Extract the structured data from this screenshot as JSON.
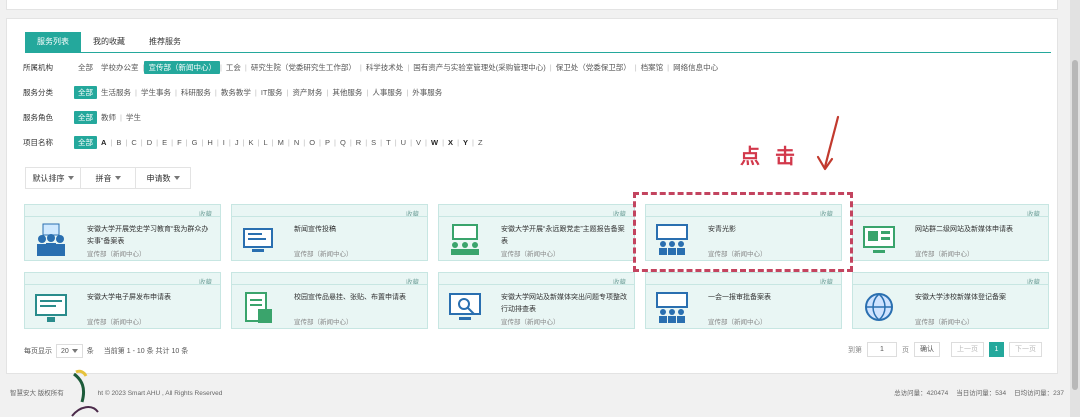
{
  "tabs": [
    {
      "label": "服务列表",
      "active": true
    },
    {
      "label": "我的收藏",
      "active": false
    },
    {
      "label": "推荐服务",
      "active": false
    }
  ],
  "filters": {
    "org": {
      "label": "所属机构",
      "items": [
        "全部",
        "学校办公室",
        "宣传部（新闻中心）",
        "工会",
        "研究生院（党委研究生工作部）",
        "科学技术处",
        "国有资产与实验室管理处(采购管理中心)",
        "保卫处（党委保卫部）",
        "档案馆",
        "网络信息中心"
      ],
      "selected": "宣传部（新闻中心）"
    },
    "category": {
      "label": "服务分类",
      "items": [
        "全部",
        "生活服务",
        "学生事务",
        "科研服务",
        "教务教学",
        "IT服务",
        "资产财务",
        "其他服务",
        "人事服务",
        "外事服务"
      ],
      "selected": "全部"
    },
    "role": {
      "label": "服务角色",
      "items": [
        "全部",
        "教师",
        "学生"
      ],
      "selected": "全部"
    },
    "name": {
      "label": "项目名称",
      "items": [
        "全部",
        "A",
        "B",
        "C",
        "D",
        "E",
        "F",
        "G",
        "H",
        "I",
        "J",
        "K",
        "L",
        "M",
        "N",
        "O",
        "P",
        "Q",
        "R",
        "S",
        "T",
        "U",
        "V",
        "W",
        "X",
        "Y",
        "Z"
      ],
      "selected": "全部",
      "bold": [
        "A",
        "W",
        "X",
        "Y"
      ]
    }
  },
  "sort": [
    "默认排序",
    "拼音",
    "申请数"
  ],
  "fav_label": "收藏",
  "cards": [
    {
      "title": "安徽大学开展党史学习教育“我为群众办实事”备案表",
      "dept": "宣传部（新闻中心）",
      "icon": "people-group-icon"
    },
    {
      "title": "新闻宣传投稿",
      "dept": "宣传部（新闻中心）",
      "icon": "monitor-edit-icon"
    },
    {
      "title": "安徽大学开展“永远跟党走”主题报告备案表",
      "dept": "宣传部（新闻中心）",
      "icon": "meeting-icon"
    },
    {
      "title": "安青光影",
      "dept": "宣传部（新闻中心）",
      "icon": "presentation-icon"
    },
    {
      "title": "网站群二级网站及新媒体申请表",
      "dept": "宣传部（新闻中心）",
      "icon": "desktop-icon"
    },
    {
      "title": "安徽大学电子屏发布申请表",
      "dept": "宣传部（新闻中心）",
      "icon": "screen-icon"
    },
    {
      "title": "校园宣传品悬挂、张贴、布置申请表",
      "dept": "宣传部（新闻中心）",
      "icon": "document-icon"
    },
    {
      "title": "安徽大学网站及新媒体突出问题专项整改行动排查表",
      "dept": "宣传部（新闻中心）",
      "icon": "search-screen-icon"
    },
    {
      "title": "一会一报审批备案表",
      "dept": "宣传部（新闻中心）",
      "icon": "presentation-icon"
    },
    {
      "title": "安徽大学涉校新媒体登记备案",
      "dept": "宣传部（新闻中心）",
      "icon": "globe-icon"
    }
  ],
  "annotation": "点 击",
  "pager": {
    "per_page_label": "每页显示",
    "per_page_value": "20",
    "per_page_unit": "条",
    "summary": "当前第 1 - 10 条 共计 10 条",
    "goto_label": "到第",
    "goto_value": "1",
    "page_unit": "页",
    "go_label": "确认",
    "prev_label": "上一页",
    "current_page": "1",
    "next_label": "下一页"
  },
  "footer": {
    "left_a": "智慧安大 版权所有",
    "left_b": "ht © 2023 Smart AHU , All Rights Reserved",
    "total_visits": "总访问量：420474",
    "today_visits": "当日访问量：534",
    "daily_avg": "日均访问量：237"
  },
  "colors": {
    "accent": "#24a89c",
    "annotation": "#d2384b",
    "card_bg": "#e9f6f4"
  }
}
